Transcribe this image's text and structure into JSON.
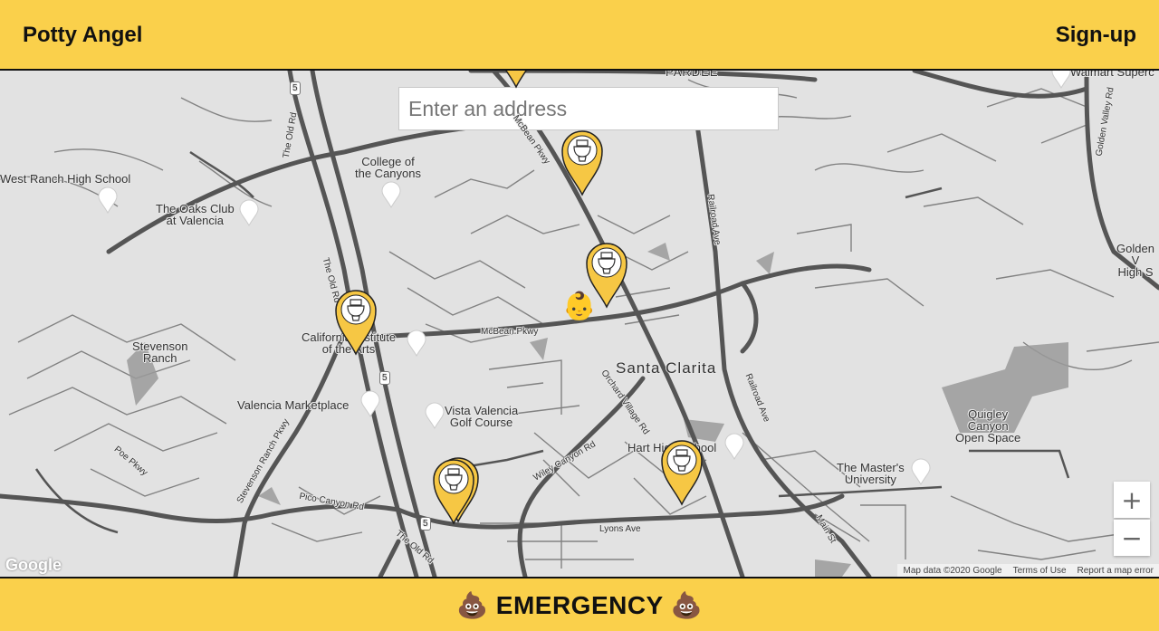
{
  "header": {
    "brand": "Potty Angel",
    "signup_label": "Sign-up"
  },
  "search": {
    "placeholder": "Enter an address"
  },
  "map": {
    "places": {
      "west_ranch": "West Ranch High School",
      "oaks_club": "The Oaks Club\nat Valencia",
      "college": "College of\nthe Canyons",
      "stevenson": "Stevenson\nRanch",
      "calarts": "California Institute\nof the Arts",
      "valencia_mkt": "Valencia Marketplace",
      "vista": "Vista Valencia\nGolf Course",
      "santa_clarita": "Santa Clarita",
      "hart": "Hart High School",
      "quigley": "Quigley\nCanyon\nOpen Space",
      "masters": "The Master's\nUniversity",
      "golden": "Golden V\nHigh S",
      "walmart": "Walmart Superc",
      "pardee": "PARDEE"
    },
    "streets": {
      "old_rd_top": "The Old Rd",
      "old_rd_mid": "The Old Rd",
      "old_rd_bot": "The Old Rd",
      "mcbean": "McBean Pkwy",
      "mcbean_top": "McBean Pkwy",
      "orchard": "Orchard Village Rd",
      "railroad_top": "Railroad Ave",
      "railroad_mid": "Railroad Ave",
      "wiley": "Wiley Canyon Rd",
      "lyons": "Lyons Ave",
      "pico": "Pico Canyon Rd",
      "stevenson_pkwy": "Stevenson Ranch Pkwy",
      "poe": "Poe Pkwy",
      "main": "Main St",
      "golden_valley": "Golden Valley Rd"
    },
    "route_5": "5",
    "user_marker": "👶",
    "zoom_in": "+",
    "zoom_out": "−",
    "google": "Google",
    "attribution": {
      "map_data": "Map data ©2020 Google",
      "terms": "Terms of Use",
      "report": "Report a map error"
    }
  },
  "footer": {
    "emergency_label": "💩 EMERGENCY 💩"
  },
  "colors": {
    "accent": "#fad04b",
    "map_bg": "#e2e2e2",
    "road": "#555555",
    "pin": "#f6c744"
  }
}
